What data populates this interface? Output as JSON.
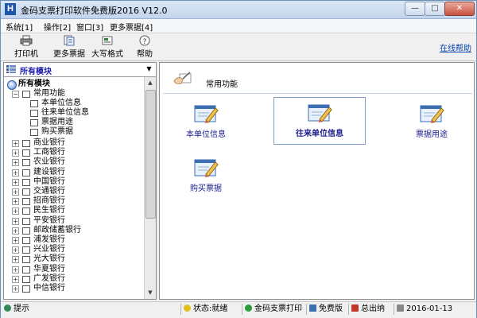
{
  "window": {
    "app_icon_letter": "H",
    "title": "金码支票打印软件免费版2016  V12.0",
    "minimize": "—",
    "maximize": "□",
    "close": "✕"
  },
  "menu": {
    "items": [
      "系统[1]",
      "操作[2]",
      "窗口[3]",
      "更多票据[4]"
    ]
  },
  "toolbar": {
    "buttons": [
      {
        "label": "打印机",
        "icon": "printer-icon"
      },
      {
        "label": "更多票据",
        "icon": "notes-icon"
      },
      {
        "label": "大写格式",
        "icon": "format-icon"
      },
      {
        "label": "帮助",
        "icon": "help-icon"
      }
    ],
    "online_help": "在线帮助"
  },
  "left_panel": {
    "module_select": "所有模块",
    "dropdown_arrow": "▼",
    "tree": {
      "root": "所有模块",
      "common": "常用功能",
      "common_children": [
        "本单位信息",
        "往来单位信息",
        "票据用途",
        "购买票据"
      ],
      "banks": [
        "商业银行",
        "工商银行",
        "农业银行",
        "建设银行",
        "中国银行",
        "交通银行",
        "招商银行",
        "民生银行",
        "平安银行",
        "邮政储蓄银行",
        "浦发银行",
        "兴业银行",
        "光大银行",
        "华夏银行",
        "广发银行",
        "中信银行"
      ]
    },
    "scroll_up": "▲",
    "scroll_down": "▼"
  },
  "right_panel": {
    "section_title": "常用功能",
    "features": [
      {
        "label": "本单位信息",
        "selected": false
      },
      {
        "label": "往来单位信息",
        "selected": true
      },
      {
        "label": "票据用途",
        "selected": false
      },
      {
        "label": "购买票据",
        "selected": false
      }
    ]
  },
  "statusbar": {
    "hint": "提示",
    "status": "状态:就绪",
    "product": "金码支票打印",
    "edition": "免费版",
    "total": "总出纳",
    "date": "2016-01-13"
  },
  "colors": {
    "link": "#0645ad",
    "feature_text": "#1a1a8a",
    "module_text": "#1a1aa8"
  }
}
